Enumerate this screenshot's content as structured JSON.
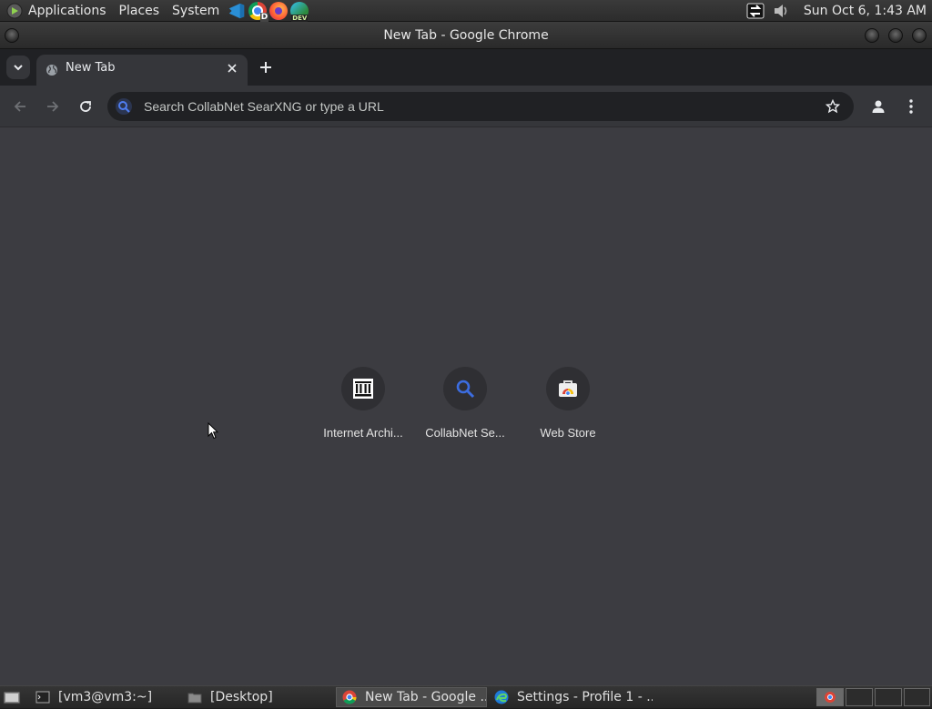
{
  "top_panel": {
    "menus": [
      "Applications",
      "Places",
      "System"
    ],
    "launcher_icons": [
      "vscode-icon",
      "chrome-dev-icon",
      "firefox-icon",
      "edge-dev-icon"
    ],
    "launcher_badges": {
      "chrome_dev": "D",
      "edge_dev": "DEV"
    },
    "clock": "Sun Oct  6,  1:43 AM"
  },
  "window": {
    "title": "New Tab - Google Chrome"
  },
  "browser": {
    "tabs": [
      {
        "title": "New Tab",
        "active": true
      }
    ],
    "omnibox": {
      "placeholder": "Search CollabNet SearXNG or type a URL",
      "value": ""
    }
  },
  "new_tab_page": {
    "shortcuts": [
      {
        "label": "Internet Archi...",
        "icon": "archive-icon"
      },
      {
        "label": "CollabNet Se...",
        "icon": "search-icon"
      },
      {
        "label": "Web Store",
        "icon": "webstore-icon"
      }
    ]
  },
  "taskbar": {
    "tasks": [
      {
        "label": "[vm3@vm3:~]",
        "icon": "terminal-icon",
        "active": false
      },
      {
        "label": "[Desktop]",
        "icon": "folder-icon",
        "active": false
      },
      {
        "label": "New Tab - Google ...",
        "icon": "chrome-icon",
        "active": true
      },
      {
        "label": "Settings - Profile 1 - ...",
        "icon": "edge-icon",
        "active": false
      }
    ]
  },
  "colors": {
    "page_background": "#3c3c41",
    "toolbar": "#35363a",
    "tabstrip": "#202124",
    "accent_blue": "#3c6de0"
  }
}
